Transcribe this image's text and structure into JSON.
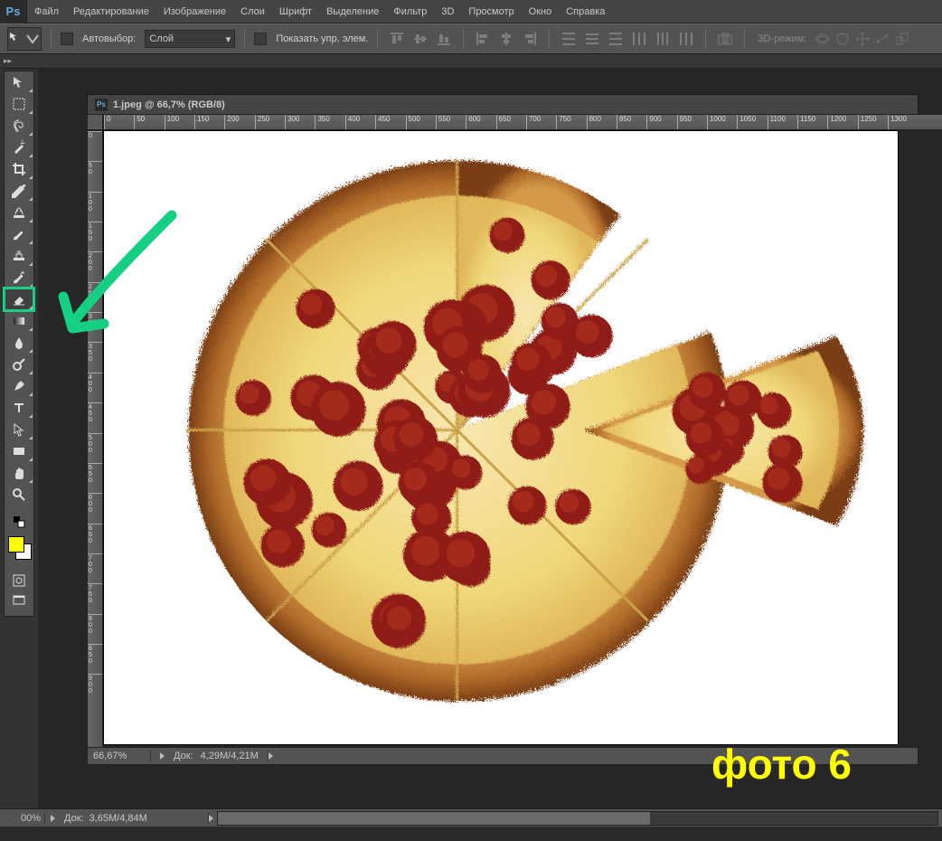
{
  "menu": {
    "items": [
      "Файл",
      "Редактирование",
      "Изображение",
      "Слои",
      "Шрифт",
      "Выделение",
      "Фильтр",
      "3D",
      "Просмотр",
      "Окно",
      "Справка"
    ]
  },
  "options": {
    "auto_select_label": "Автовыбор:",
    "layer_select_value": "Слой",
    "show_controls_label": "Показать упр. элем.",
    "mode3d_label": "3D-режим:"
  },
  "document": {
    "tab_title": "1.jpeg @ 66,7% (RGB/8)",
    "zoom_pct": "66,67%",
    "doc_info_label": "Док:",
    "doc_info_value": "4,29M/4,21M"
  },
  "outer_status": {
    "zoom": "00%",
    "doc_info_label": "Док:",
    "doc_info_value": "3,65M/4,84M"
  },
  "ruler": {
    "h_ticks": [
      0,
      50,
      100,
      150,
      200,
      250,
      300,
      350,
      400,
      450,
      500,
      550,
      600,
      650,
      700,
      750,
      800,
      850,
      900,
      950,
      1000,
      1050,
      1100,
      1150,
      1200,
      1250,
      1300
    ],
    "v_ticks": [
      0,
      50,
      100,
      150,
      200,
      250,
      300,
      350,
      400,
      450,
      500,
      550,
      600,
      650,
      700,
      750,
      800,
      850,
      900
    ]
  },
  "colors": {
    "foreground": "#ffff00",
    "background": "#ffffff",
    "annotation_green": "#15d082"
  },
  "annotation": {
    "label": "фото 6"
  },
  "toolbox": {
    "tools": [
      "move-tool",
      "rect-marquee-tool",
      "lasso-tool",
      "magic-wand-tool",
      "crop-tool",
      "eyedropper-tool",
      "healing-brush-tool",
      "brush-tool",
      "clone-stamp-tool",
      "history-brush-tool",
      "eraser-tool",
      "gradient-tool",
      "blur-tool",
      "dodge-tool",
      "pen-tool",
      "type-tool",
      "path-select-tool",
      "rectangle-shape-tool",
      "hand-tool",
      "zoom-tool"
    ],
    "highlighted_index": 10
  }
}
